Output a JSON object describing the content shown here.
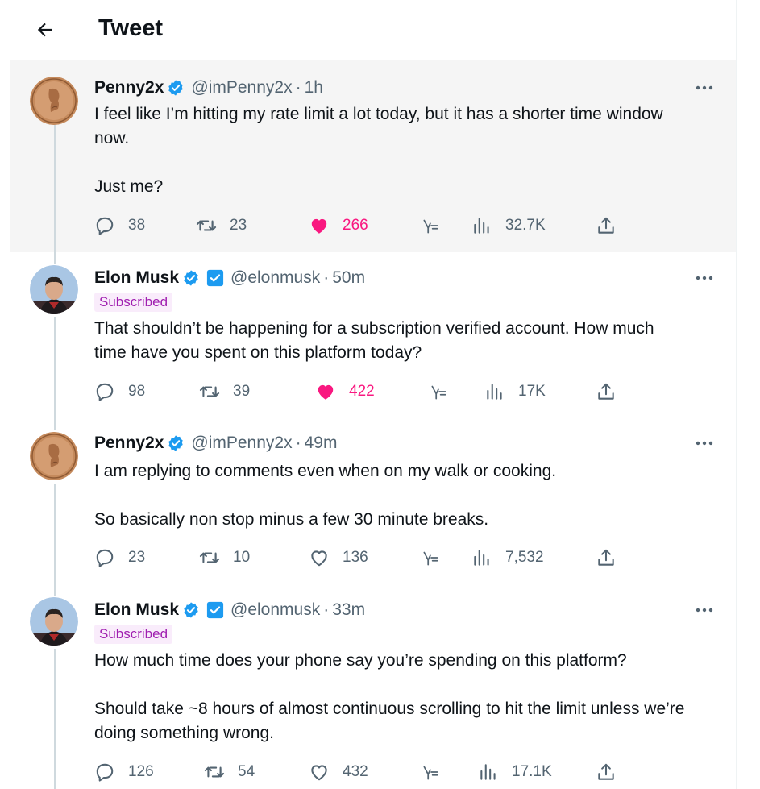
{
  "header": {
    "title": "Tweet"
  },
  "tweets": [
    {
      "display_name": "Penny2x",
      "handle": "@imPenny2x",
      "time": "1h",
      "lines": [
        "I feel like I’m hitting my rate limit a lot today, but it has a shorter time window now.",
        "",
        "Just me?"
      ],
      "replies": "38",
      "retweets": "23",
      "likes": "266",
      "views": "32.7K",
      "liked": true
    },
    {
      "display_name": "Elon Musk",
      "handle": "@elonmusk",
      "time": "50m",
      "badge": "Subscribed",
      "lines": [
        "That shouldn’t be happening for a subscription verified account. How much time have you spent on this platform today?"
      ],
      "replies": "98",
      "retweets": "39",
      "likes": "422",
      "views": "17K",
      "liked": true
    },
    {
      "display_name": "Penny2x",
      "handle": "@imPenny2x",
      "time": "49m",
      "lines": [
        "I am replying to comments even when on my walk or cooking.",
        "",
        "So basically non stop minus a few 30 minute breaks."
      ],
      "replies": "23",
      "retweets": "10",
      "likes": "136",
      "views": "7,532",
      "liked": false
    },
    {
      "display_name": "Elon Musk",
      "handle": "@elonmusk",
      "time": "33m",
      "badge": "Subscribed",
      "lines": [
        "How much time does your phone say you’re spending on this platform?",
        "",
        "Should take ~8 hours of almost continuous scrolling to hit the limit unless we’re doing something wrong."
      ],
      "replies": "126",
      "retweets": "54",
      "likes": "432",
      "views": "17.1K",
      "liked": false
    }
  ],
  "separator": "·",
  "colors": {
    "verified": "#1d9bf0",
    "like": "#f91880",
    "muted": "#536471",
    "gov": "#829aab"
  }
}
